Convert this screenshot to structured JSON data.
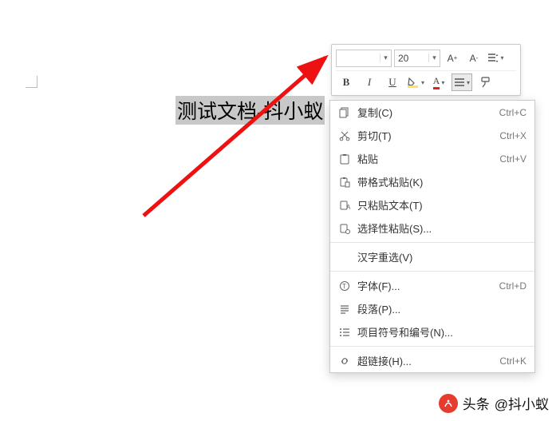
{
  "document": {
    "selected_text": "测试文档-抖小蚁"
  },
  "toolbar": {
    "font_name": "",
    "font_size": "20",
    "grow": "A⁺",
    "shrink": "A⁻"
  },
  "row2": {
    "bold": "B",
    "italic": "I",
    "underline": "U"
  },
  "menu": {
    "copy": {
      "label": "复制(C)",
      "shortcut": "Ctrl+C"
    },
    "cut": {
      "label": "剪切(T)",
      "shortcut": "Ctrl+X"
    },
    "paste": {
      "label": "粘贴",
      "shortcut": "Ctrl+V"
    },
    "paste_fmt": {
      "label": "带格式粘贴(K)"
    },
    "paste_text": {
      "label": "只粘贴文本(T)"
    },
    "paste_special": {
      "label": "选择性粘贴(S)..."
    },
    "reselect": {
      "label": "汉字重选(V)"
    },
    "font": {
      "label": "字体(F)...",
      "shortcut": "Ctrl+D"
    },
    "paragraph": {
      "label": "段落(P)..."
    },
    "bullets": {
      "label": "项目符号和编号(N)..."
    },
    "hyperlink": {
      "label": "超链接(H)...",
      "shortcut": "Ctrl+K"
    }
  },
  "watermark": {
    "prefix": "头条",
    "at": "@抖小蚁"
  }
}
